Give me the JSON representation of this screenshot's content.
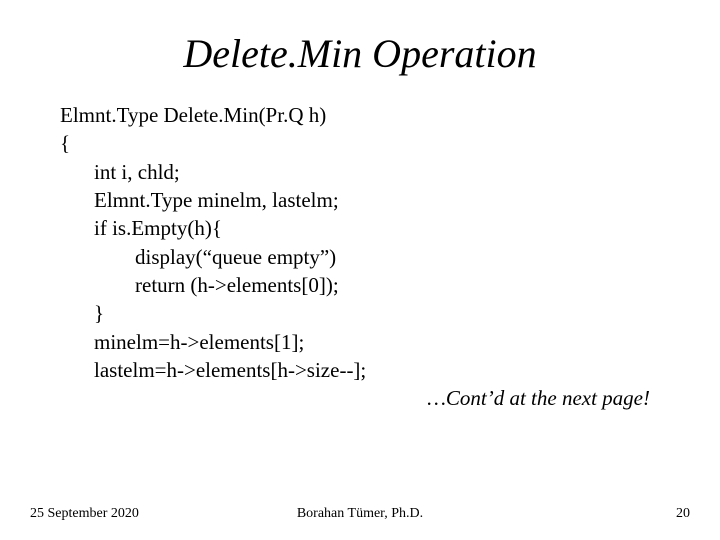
{
  "title": "Delete.Min Operation",
  "code": {
    "l0": "Elmnt.Type Delete.Min(Pr.Q h)",
    "l1": "{",
    "l2": "int i, chld;",
    "l3": "Elmnt.Type minelm, lastelm;",
    "l4": "if is.Empty(h){",
    "l5": "display(“queue empty”)",
    "l6": "return (h->elements[0]);",
    "l7": "}",
    "l8": "minelm=h->elements[1];",
    "l9": "lastelm=h->elements[h->size--];"
  },
  "cont": "…Cont’d at the next page!",
  "footer": {
    "date": "25 September 2020",
    "author": "Borahan Tümer, Ph.D.",
    "page": "20"
  }
}
